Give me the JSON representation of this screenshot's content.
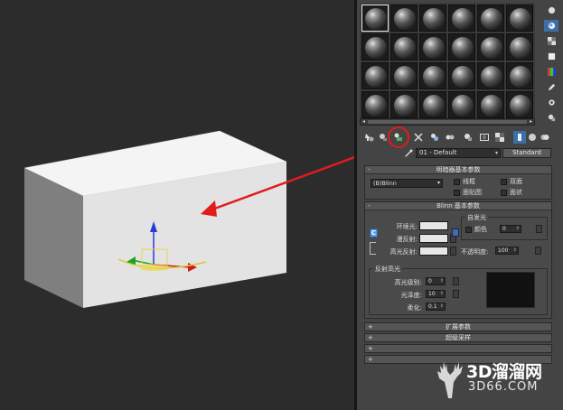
{
  "material": {
    "name": "01 - Default",
    "type": "Standard"
  },
  "shader_basic": {
    "title": "明暗器基本参数",
    "shader": "(B)Blinn",
    "options": [
      "线框",
      "双面",
      "面贴图",
      "面状"
    ]
  },
  "blinn": {
    "title": "Blinn 基本参数",
    "ambient_label": "环境光:",
    "diffuse_label": "漫反射:",
    "specular_label": "高光反射:",
    "self_illum_title": "自发光",
    "self_illum_color_label": "颜色",
    "self_illum_value": "0",
    "opacity_label": "不透明度:",
    "opacity_value": "100",
    "highlight_title": "反射高光",
    "spec_level_label": "高光级别:",
    "spec_level_value": "0",
    "glossiness_label": "光泽度:",
    "glossiness_value": "10",
    "soften_label": "柔化:",
    "soften_value": "0.1",
    "lock_label": "C",
    "ambient_color": "#e6e6e6",
    "diffuse_color": "#e6e6e6",
    "specular_color": "#e6e6e6"
  },
  "rollouts_collapsed": [
    "扩展参数",
    "超级采样"
  ],
  "watermark": {
    "title": "3D溜溜网",
    "url": "3D66.COM"
  },
  "colors": {
    "annotation_red": "#e21b1b",
    "panel_bg": "#444444",
    "viewport_bg": "#2c2c2c"
  }
}
